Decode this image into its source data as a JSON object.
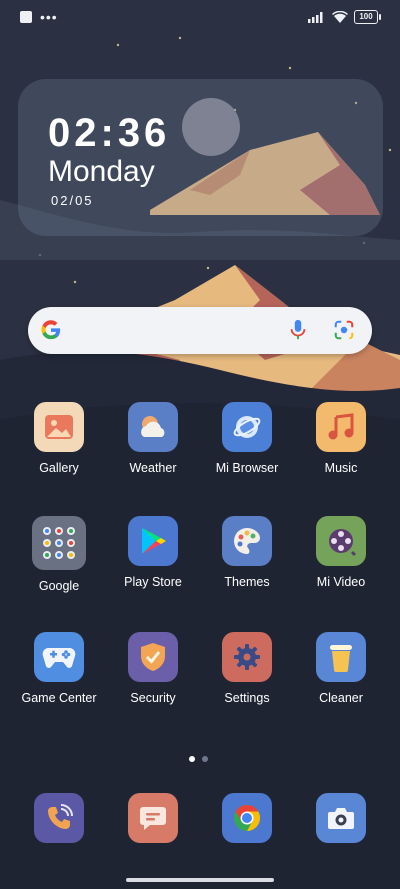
{
  "status_bar": {
    "battery": "100",
    "icons": [
      "notification-square-icon",
      "more-dots-icon",
      "signal-icon",
      "wifi-icon",
      "battery-icon"
    ]
  },
  "clock_widget": {
    "time": "02:36",
    "day": "Monday",
    "date": "02/05"
  },
  "search_bar": {
    "icons": [
      "google-g-icon",
      "microphone-icon",
      "google-lens-icon"
    ]
  },
  "apps": [
    {
      "label": "Gallery",
      "icon": "gallery-icon"
    },
    {
      "label": "Weather",
      "icon": "weather-icon"
    },
    {
      "label": "Mi Browser",
      "icon": "mi-browser-icon"
    },
    {
      "label": "Music",
      "icon": "music-icon"
    },
    {
      "label": "Google",
      "icon": "google-folder-icon"
    },
    {
      "label": "Play Store",
      "icon": "play-store-icon"
    },
    {
      "label": "Themes",
      "icon": "themes-icon"
    },
    {
      "label": "Mi Video",
      "icon": "mi-video-icon"
    },
    {
      "label": "Game Center",
      "icon": "game-center-icon"
    },
    {
      "label": "Security",
      "icon": "security-icon"
    },
    {
      "label": "Settings",
      "icon": "settings-icon"
    },
    {
      "label": "Cleaner",
      "icon": "cleaner-icon"
    }
  ],
  "dock": [
    {
      "icon": "phone-icon"
    },
    {
      "icon": "messages-icon"
    },
    {
      "icon": "chrome-icon"
    },
    {
      "icon": "camera-icon"
    }
  ],
  "page_indicator": {
    "pages": 2,
    "current": 1
  },
  "colors": {
    "sky": "#2b3142",
    "mountain_light": "#e6b97f",
    "mountain_dark": "#b5645a",
    "hill": "#202636"
  }
}
